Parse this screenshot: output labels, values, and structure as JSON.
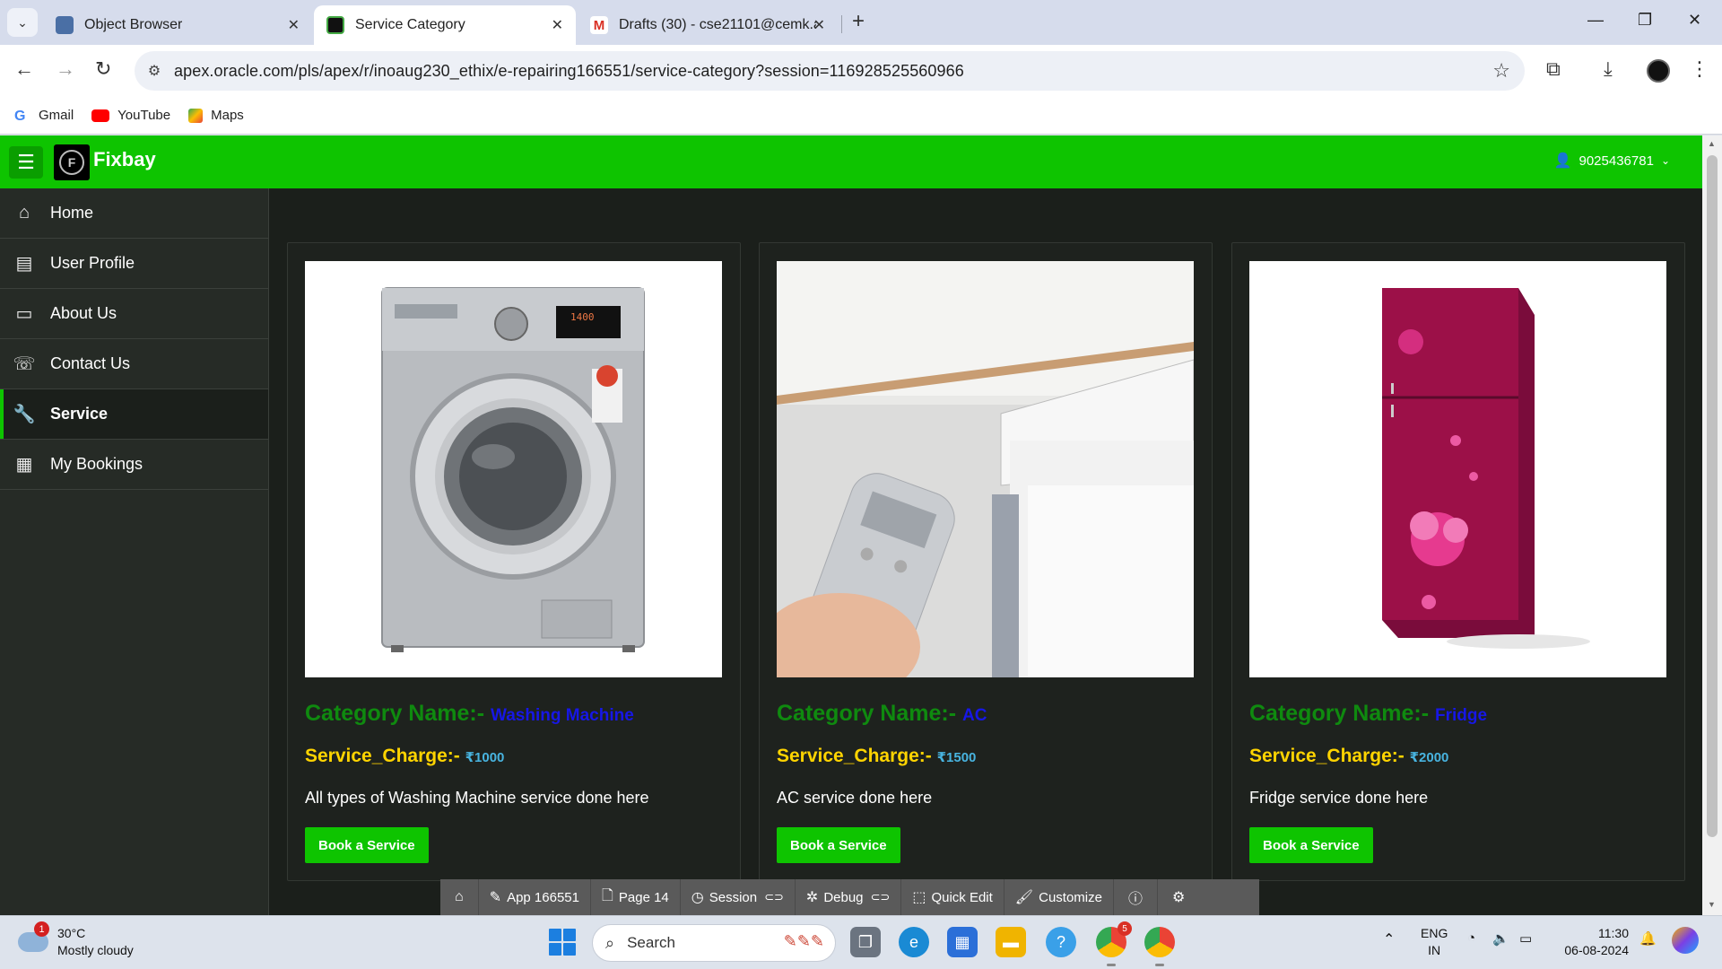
{
  "browser": {
    "tabs": [
      {
        "label": "Object Browser",
        "active": false,
        "favicon_color": "#4a6fa5"
      },
      {
        "label": "Service Category",
        "active": true,
        "favicon_color": "#111111"
      },
      {
        "label": "Drafts (30) - cse21101@cemk.ac",
        "active": false,
        "favicon_color": "#d93025"
      }
    ],
    "url": "apex.oracle.com/pls/apex/r/inoaug230_ethix/e-repairing166551/service-category?session=116928525560966",
    "bookmarks": [
      {
        "label": "Gmail",
        "color": "#4285f4"
      },
      {
        "label": "YouTube",
        "color": "#ff0000"
      },
      {
        "label": "Maps",
        "color": "#34a853"
      }
    ]
  },
  "app": {
    "brand": "Fixbay",
    "logo_letter": "F",
    "user": "9025436781",
    "accent_color": "#0ec400",
    "nav": [
      {
        "label": "Home",
        "icon": "home-icon",
        "glyph": "⌂",
        "current": false
      },
      {
        "label": "User Profile",
        "icon": "user-profile-icon",
        "glyph": "▤",
        "current": false
      },
      {
        "label": "About Us",
        "icon": "about-us-icon",
        "glyph": "▭",
        "current": false
      },
      {
        "label": "Contact Us",
        "icon": "contact-us-icon",
        "glyph": "☏",
        "current": false
      },
      {
        "label": "Service",
        "icon": "wrench-icon",
        "glyph": "🔧",
        "current": true
      },
      {
        "label": "My Bookings",
        "icon": "table-icon",
        "glyph": "▦",
        "current": false
      }
    ],
    "cards": [
      {
        "category_prefix": "Category Name:-",
        "category": "Washing Machine",
        "charge_prefix": "Service_Charge:-",
        "charge": "₹1000",
        "description": "All types of Washing Machine service done here",
        "button": "Book a Service",
        "image": "washing-machine-image"
      },
      {
        "category_prefix": "Category Name:-",
        "category": "AC",
        "charge_prefix": "Service_Charge:-",
        "charge": "₹1500",
        "description": "AC service done here",
        "button": "Book a Service",
        "image": "air-conditioner-image"
      },
      {
        "category_prefix": "Category Name:-",
        "category": "Fridge",
        "charge_prefix": "Service_Charge:-",
        "charge": "₹2000",
        "description": "Fridge service done here",
        "button": "Book a Service",
        "image": "fridge-image"
      }
    ]
  },
  "devbar": {
    "items": [
      {
        "label": "",
        "icon": "home-icon"
      },
      {
        "label": "App 166551",
        "icon": "edit-icon"
      },
      {
        "label": "Page 14",
        "icon": "page-icon"
      },
      {
        "label": "Session",
        "icon": "session-icon",
        "toggle": true
      },
      {
        "label": "Debug",
        "icon": "bug-icon",
        "toggle": true
      },
      {
        "label": "Quick Edit",
        "icon": "quick-edit-icon"
      },
      {
        "label": "Customize",
        "icon": "brush-icon"
      },
      {
        "label": "",
        "icon": "info-icon"
      },
      {
        "label": "",
        "icon": "gear-icon"
      }
    ]
  },
  "taskbar": {
    "weather_temp": "30°C",
    "weather_desc": "Mostly cloudy",
    "weather_badge": "1",
    "search_placeholder": "Search",
    "lang_line1": "ENG",
    "lang_line2": "IN",
    "time": "11:30",
    "date": "06-08-2024",
    "chrome_badge": "5"
  }
}
